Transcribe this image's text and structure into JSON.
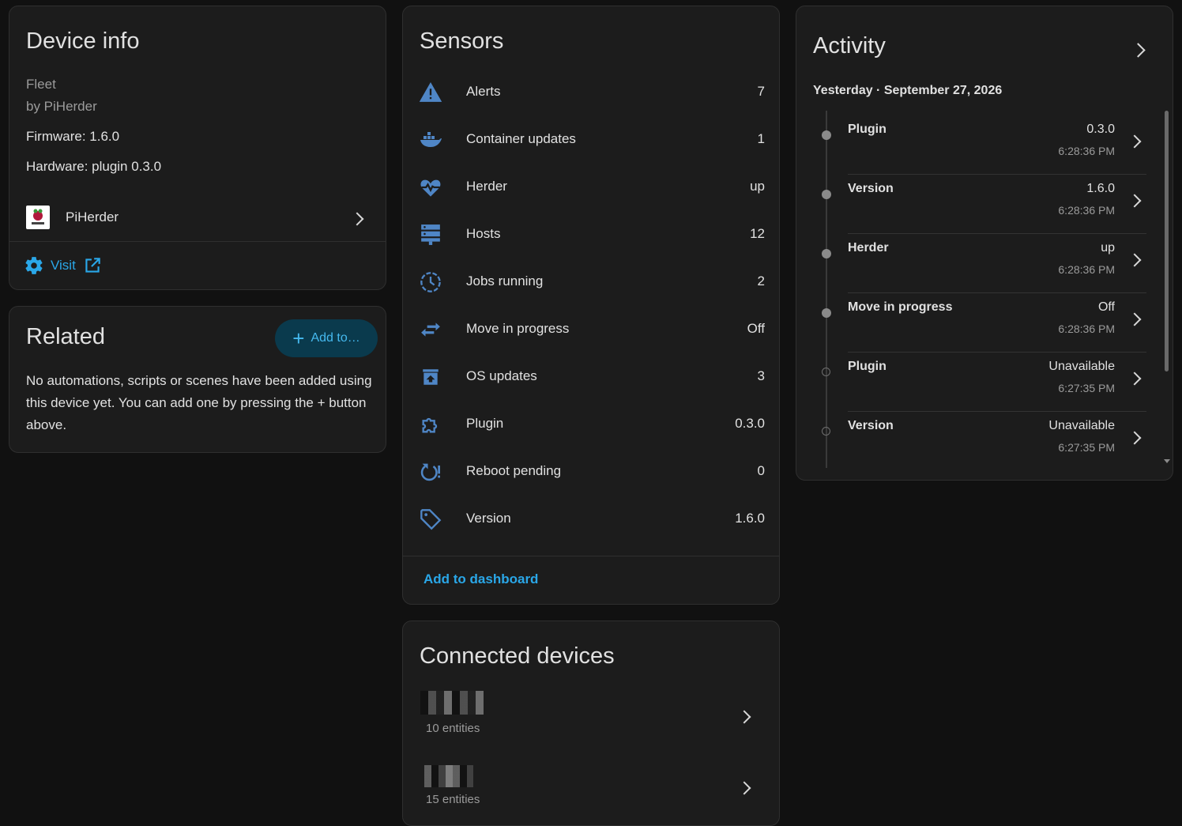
{
  "device_info": {
    "title": "Device info",
    "model": "Fleet",
    "manufacturer": "by PiHerder",
    "firmware": "Firmware: 1.6.0",
    "hardware": "Hardware: plugin 0.3.0",
    "integration_label": "PiHerder",
    "visit_label": "Visit"
  },
  "related": {
    "title": "Related",
    "add_label": "Add to…",
    "empty_text": "No automations, scripts or scenes have been added using this device yet. You can add one by pressing the + button above."
  },
  "sensors": {
    "title": "Sensors",
    "items": [
      {
        "icon": "alert-icon",
        "name": "Alerts",
        "value": "7"
      },
      {
        "icon": "docker-icon",
        "name": "Container updates",
        "value": "1"
      },
      {
        "icon": "heart-pulse-icon",
        "name": "Herder",
        "value": "up"
      },
      {
        "icon": "server-icon",
        "name": "Hosts",
        "value": "12"
      },
      {
        "icon": "clock-icon",
        "name": "Jobs running",
        "value": "2"
      },
      {
        "icon": "swap-icon",
        "name": "Move in progress",
        "value": "Off"
      },
      {
        "icon": "package-up-icon",
        "name": "OS updates",
        "value": "3"
      },
      {
        "icon": "puzzle-icon",
        "name": "Plugin",
        "value": "0.3.0"
      },
      {
        "icon": "restart-alert-icon",
        "name": "Reboot pending",
        "value": "0"
      },
      {
        "icon": "tag-icon",
        "name": "Version",
        "value": "1.6.0"
      }
    ],
    "add_to_dashboard": "Add to dashboard"
  },
  "connected": {
    "title": "Connected devices",
    "items": [
      {
        "entities": "10 entities"
      },
      {
        "entities": "15 entities"
      }
    ]
  },
  "activity": {
    "title": "Activity",
    "date_header": "Yesterday · September 27, 2026",
    "items": [
      {
        "name": "Plugin",
        "state": "0.3.0",
        "time": "6:28:36 PM",
        "dot": "filled"
      },
      {
        "name": "Version",
        "state": "1.6.0",
        "time": "6:28:36 PM",
        "dot": "filled"
      },
      {
        "name": "Herder",
        "state": "up",
        "time": "6:28:36 PM",
        "dot": "filled"
      },
      {
        "name": "Move in progress",
        "state": "Off",
        "time": "6:28:36 PM",
        "dot": "filled"
      },
      {
        "name": "Plugin",
        "state": "Unavailable",
        "time": "6:27:35 PM",
        "dot": "hollow"
      },
      {
        "name": "Version",
        "state": "Unavailable",
        "time": "6:27:35 PM",
        "dot": "hollow"
      }
    ]
  },
  "colors": {
    "accent": "#2aa7e8",
    "icon": "#4f86c6",
    "card_bg": "#1c1c1c",
    "page_bg": "#111111"
  }
}
